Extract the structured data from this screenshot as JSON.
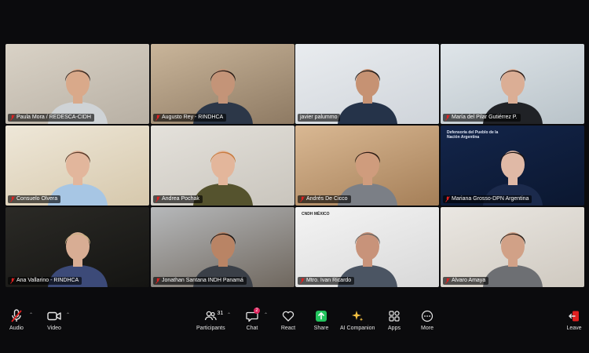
{
  "colors": {
    "background": "#0b0b0d",
    "active_speaker_border": "#1db954",
    "mic_muted": "#e02020",
    "share_green": "#23c45e",
    "chat_badge": "#e0245e"
  },
  "participants": [
    {
      "name": "Paula Mora / REDESCA-CIDH",
      "muted": true,
      "active": false,
      "bg": [
        "#d9d2c6",
        "#b8b0a4"
      ],
      "skin": "#d9a98a",
      "hair": "#3a2a22",
      "shirt": "#cfd3d6"
    },
    {
      "name": "Augusto Rey - RINDHCA",
      "muted": true,
      "active": false,
      "bg": [
        "#c9b59a",
        "#8e7a63"
      ],
      "skin": "#c49478",
      "hair": "#2a1d17",
      "shirt": "#2c3748"
    },
    {
      "name": "javier palummo",
      "muted": false,
      "active": true,
      "bg": [
        "#e9ecef",
        "#cfd4da"
      ],
      "skin": "#c69273",
      "hair": "#1e1a18",
      "shirt": "#253349"
    },
    {
      "name": "María del Pilar Gutiérrez P.",
      "muted": true,
      "active": false,
      "bg": [
        "#dfe5e9",
        "#b9c3c9"
      ],
      "skin": "#dbae95",
      "hair": "#2c1d18",
      "shirt": "#202226"
    },
    {
      "name": "Consuelo Olvera",
      "muted": true,
      "active": false,
      "bg": [
        "#eee7d8",
        "#d6c8ac"
      ],
      "skin": "#e2b69c",
      "hair": "#5a3b2a",
      "shirt": "#a7c6e4"
    },
    {
      "name": "Andrea Pochak",
      "muted": true,
      "active": false,
      "bg": [
        "#e4e1db",
        "#c9c5bd"
      ],
      "skin": "#e3b69b",
      "hair": "#c77a3d",
      "shirt": "#55532e"
    },
    {
      "name": "Andrés De Cicco",
      "muted": true,
      "active": false,
      "bg": [
        "#d9b893",
        "#a57f58"
      ],
      "skin": "#cf9c7d",
      "hair": "#2b1c14",
      "shirt": "#7b7f86"
    },
    {
      "name": "Mariana Grosso-DPN Argentina",
      "muted": true,
      "active": false,
      "bg": [
        "#13254a",
        "#0b1730"
      ],
      "skin": "#e0b9a6",
      "hair": "#1c1512",
      "shirt": "#1b2a4c",
      "logo_text": "Defensoría del Pueblo de la Nación Argentina"
    },
    {
      "name": "Ana Vallarino - RINDHCA",
      "muted": true,
      "active": false,
      "bg": [
        "#2b2a26",
        "#141412"
      ],
      "skin": "#d8ad94",
      "hair": "#c9b083",
      "shirt": "#3c4a78"
    },
    {
      "name": "Jonathan Santana INDH Panamá",
      "muted": true,
      "active": false,
      "bg": [
        "#b6b8ba",
        "#6f675e"
      ],
      "skin": "#b98465",
      "hair": "#1c1614",
      "shirt": "#3a3f47"
    },
    {
      "name": "Mtro. Ivan Ricardo",
      "muted": true,
      "active": false,
      "bg": [
        "#f4f4f4",
        "#d8d8d8"
      ],
      "skin": "#c8937a",
      "hair": "#6a6561",
      "shirt": "#4b5563",
      "logo_text": "CNDH MÉXICO"
    },
    {
      "name": "Alvaro Amaya",
      "muted": true,
      "active": false,
      "bg": [
        "#eae7e2",
        "#cfc9c0"
      ],
      "skin": "#d1a187",
      "hair": "#2d231d",
      "shirt": "#6d6f73"
    }
  ],
  "toolbar": {
    "audio": {
      "label": "Audio",
      "icon": "mic-muted-icon"
    },
    "video": {
      "label": "Video",
      "icon": "video-camera-icon"
    },
    "participants": {
      "label": "Participants",
      "icon": "people-icon",
      "count": "31"
    },
    "chat": {
      "label": "Chat",
      "icon": "chat-bubble-icon",
      "badge": "2"
    },
    "react": {
      "label": "React",
      "icon": "heart-icon"
    },
    "share": {
      "label": "Share",
      "icon": "share-arrow-icon"
    },
    "ai_companion": {
      "label": "AI Companion",
      "icon": "sparkle-icon"
    },
    "apps": {
      "label": "Apps",
      "icon": "apps-grid-icon"
    },
    "more": {
      "label": "More",
      "icon": "more-dots-icon"
    },
    "leave": {
      "label": "Leave",
      "icon": "leave-door-icon"
    }
  }
}
